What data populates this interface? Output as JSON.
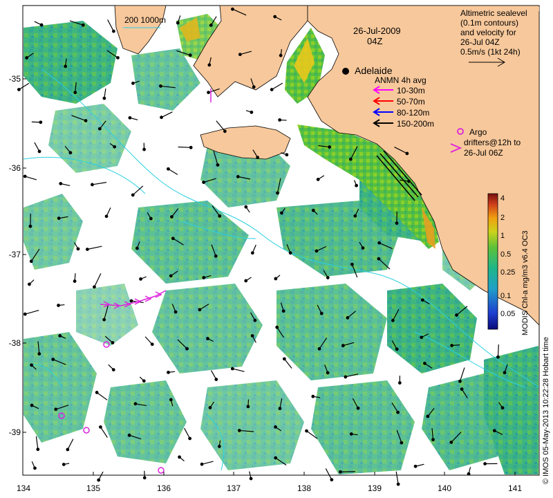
{
  "map": {
    "date": "26-Jul-2009",
    "time": "04Z",
    "scale_label": "200  1000m",
    "city": "Adelaide",
    "x_ticks": [
      "134",
      "135",
      "136",
      "137",
      "138",
      "139",
      "140",
      "141"
    ],
    "y_ticks": [
      "-35",
      "-36",
      "-37",
      "-38",
      "-39"
    ]
  },
  "legend": {
    "altimetry": [
      "Altimetric sealevel",
      "(0.1m contours)",
      "and velocity for",
      "26-Jul 04Z",
      "0.5m/s (1kt 24h)"
    ],
    "anmn_title": "ANMN 4h avg",
    "anmn_items": [
      {
        "label": "10-30m",
        "color": "#ff00ff"
      },
      {
        "label": "50-70m",
        "color": "#ff0000"
      },
      {
        "label": "80-120m",
        "color": "#0000ff"
      },
      {
        "label": "150-200m",
        "color": "#000000"
      }
    ],
    "argo": [
      "Argo",
      "drifters@12h to",
      "26-Jul 06Z"
    ]
  },
  "colorbar": {
    "label": "MODIS Chl-a mg/m3 v6.4 OC3",
    "ticks": [
      "4",
      "2",
      "1",
      "0.5",
      "0.25",
      "0.1",
      "0.05"
    ]
  },
  "credit": "© IMOS 05-May-2013 10:22:28 Hobart time",
  "colors": {
    "land": "#f7c89b",
    "chl_low": "#1aa37f",
    "chl_mid": "#55c04a",
    "chl_high": "#f4d020",
    "current": "#2ad0e0",
    "argo": "#dd22dd"
  }
}
